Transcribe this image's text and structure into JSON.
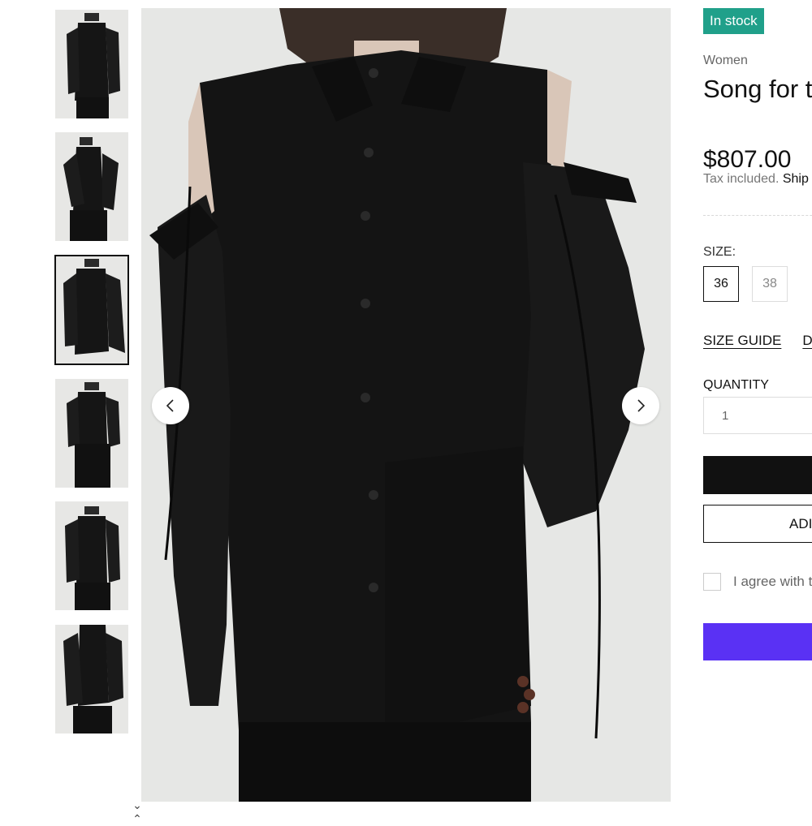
{
  "gallery": {
    "thumbnails": [
      {
        "alt": "thumbnail-1"
      },
      {
        "alt": "thumbnail-2"
      },
      {
        "alt": "thumbnail-3"
      },
      {
        "alt": "thumbnail-4"
      },
      {
        "alt": "thumbnail-5"
      },
      {
        "alt": "thumbnail-6"
      }
    ],
    "active_index": 2,
    "nav": {
      "down": "⌄",
      "up": "⌃"
    }
  },
  "product": {
    "stock_badge": "In stock",
    "vendor": "Women",
    "title": "Song for t",
    "price": "$807.00",
    "tax_note": "Tax included.",
    "shipping_link": "Ship",
    "size_label": "SIZE:",
    "sizes": [
      {
        "label": "36",
        "selected": true
      },
      {
        "label": "38",
        "selected": false
      }
    ],
    "links": {
      "size_guide": "SIZE GUIDE",
      "other": "D"
    },
    "quantity_label": "QUANTITY",
    "quantity_value": "1",
    "add_button_label": "ADI",
    "agree_text": "I agree with t"
  },
  "colors": {
    "badge": "#20a08a",
    "primary_button": "#111111",
    "buy_now": "#5a31f4"
  },
  "icons": {
    "prev": "chevron-left-icon",
    "next": "chevron-right-icon"
  }
}
